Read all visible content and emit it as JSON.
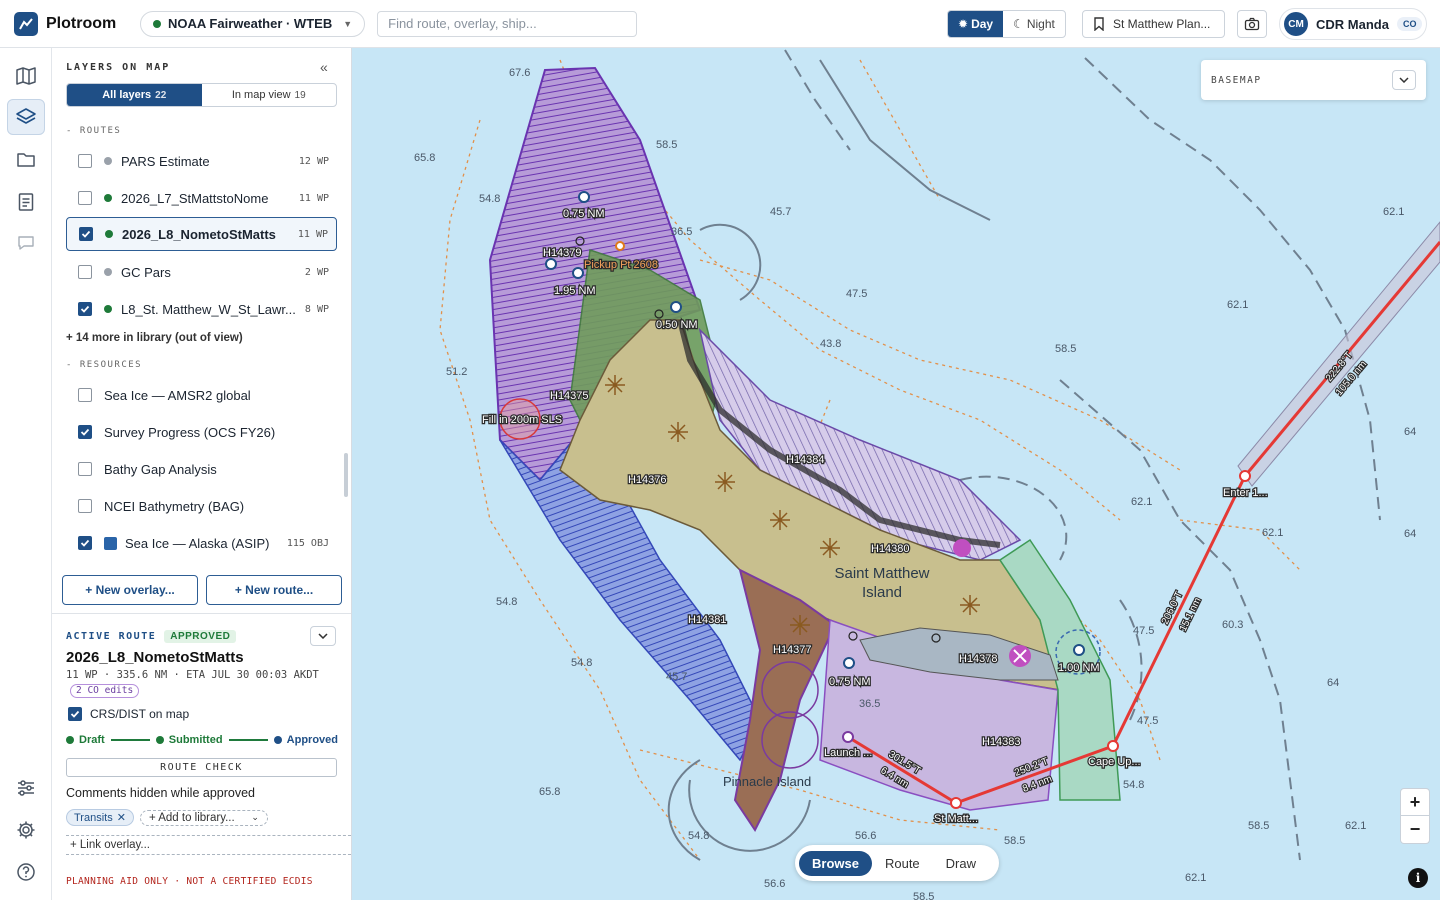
{
  "app": {
    "name": "Plotroom"
  },
  "vessel": {
    "label": "NOAA Fairweather · WTEB",
    "status_color": "#1e7a39"
  },
  "search": {
    "placeholder": "Find route, overlay, ship..."
  },
  "theme": {
    "day_label": "Day",
    "night_label": "Night",
    "active": "Day"
  },
  "plan": {
    "label": "St Matthew Plan..."
  },
  "user": {
    "initials": "CM",
    "name": "CDR Manda",
    "role": "CO"
  },
  "rail": {
    "items": [
      "map-icon",
      "layers-icon",
      "folder-icon",
      "document-icon",
      "chat-icon",
      "sliders-icon",
      "gear-icon",
      "help-icon"
    ],
    "active": "layers-icon"
  },
  "panel": {
    "title": "LAYERS ON MAP",
    "tabs": [
      {
        "label": "All layers",
        "count": "22"
      },
      {
        "label": "In map view",
        "count": "19"
      }
    ],
    "routes_heading": "- ROUTES",
    "routes": [
      {
        "name": "PARS Estimate",
        "meta": "12 WP",
        "checked": false,
        "color": "#9aa1aa"
      },
      {
        "name": "2026_L7_StMattstoNome",
        "meta": "11 WP",
        "checked": false,
        "color": "#1e7a39"
      },
      {
        "name": "2026_L8_NometoStMatts",
        "meta": "11 WP",
        "checked": true,
        "color": "#1e7a39",
        "selected": true
      },
      {
        "name": "GC Pars",
        "meta": "2 WP",
        "checked": false,
        "color": "#9aa1aa"
      },
      {
        "name": "L8_St. Matthew_W_St_Lawr...",
        "meta": "8 WP",
        "checked": true,
        "color": "#1e7a39"
      }
    ],
    "more_label": "+ 14 more in library (out of view)",
    "resources_heading": "- RESOURCES",
    "resources": [
      {
        "name": "Sea Ice — AMSR2 global",
        "meta": "",
        "checked": false
      },
      {
        "name": "Survey Progress (OCS FY26)",
        "meta": "",
        "checked": true
      },
      {
        "name": "Bathy Gap Analysis",
        "meta": "",
        "checked": false
      },
      {
        "name": "NCEI Bathymetry (BAG)",
        "meta": "",
        "checked": false
      },
      {
        "name": "Sea Ice — Alaska (ASIP)",
        "meta": "115 OBJ",
        "checked": true,
        "swatch": "#2a64a8"
      }
    ],
    "new_overlay": "+ New overlay...",
    "new_route": "+ New route..."
  },
  "active_route": {
    "label": "ACTIVE ROUTE",
    "status": "APPROVED",
    "name": "2026_L8_NometoStMatts",
    "meta": "11 WP · 335.6 NM · ETA JUL 30 00:03 AKDT",
    "edits": "2 CO edits",
    "crs_label": "CRS/DIST on map",
    "crs_checked": true,
    "steps": [
      "Draft",
      "Submitted",
      "Approved"
    ],
    "route_check": "ROUTE CHECK",
    "comments": "Comments hidden while approved",
    "tag": "Transits",
    "add_library": "+ Add to library...",
    "link_overlay": "+ Link overlay...",
    "warning": "PLANNING AID ONLY · NOT A CERTIFIED ECDIS"
  },
  "map": {
    "basemap_label": "BASEMAP",
    "modes": [
      "Browse",
      "Route",
      "Draw"
    ],
    "active_mode": "Browse",
    "zoom_in": "+",
    "zoom_out": "−",
    "info": "i",
    "island_name_1": "Saint Matthew",
    "island_name_2": "Island",
    "pinnacle_label": "Pinnacle Island",
    "depths": [
      "67.6",
      "58.5",
      "65.8",
      "54.8",
      "36.5",
      "45.7",
      "62.1",
      "47.5",
      "43.8",
      "58.5",
      "51.2",
      "62.1",
      "64",
      "62.1",
      "64",
      "62.1",
      "54.8",
      "54.8",
      "45.7",
      "60.3",
      "47.5",
      "64",
      "47.5",
      "36.5",
      "54.8",
      "65.8",
      "56.6",
      "58.5",
      "54.8",
      "58.5",
      "62.1",
      "56.6",
      "62.1",
      "58.5"
    ],
    "sheets": [
      "H14379",
      "H14375",
      "H14376",
      "H14384",
      "H14380",
      "H14381",
      "H14377",
      "H14378",
      "H14383"
    ],
    "labels": {
      "d075a": "0.75 NM",
      "d195": "1.95 NM",
      "pickup": "Pickup Pt 2608",
      "d050": "0.50 NM",
      "fill": "Fill in 200m SLS",
      "d075b": "0.75 NM",
      "d100": "1.00 NM",
      "launch": "Launch ...",
      "stmatt": "St Matt...",
      "capeup": "Cape Up...",
      "enter": "Enter 1..."
    },
    "legs": [
      {
        "course": "301.5°T",
        "dist": "6.4 nm"
      },
      {
        "course": "250.2°T",
        "dist": "8.4 nm"
      },
      {
        "course": "206.0°T",
        "dist": "15.1 nm"
      },
      {
        "course": "222.8°T",
        "dist": "105.0 nm"
      }
    ],
    "colors": {
      "route": "#e53935",
      "water": "#c7e6f6",
      "island": "#c8bf8e",
      "purple_survey": "#7b3fb6",
      "blue_survey": "#3a55c4",
      "green_survey": "#3f9a56",
      "brand": "#1f4f86"
    }
  }
}
